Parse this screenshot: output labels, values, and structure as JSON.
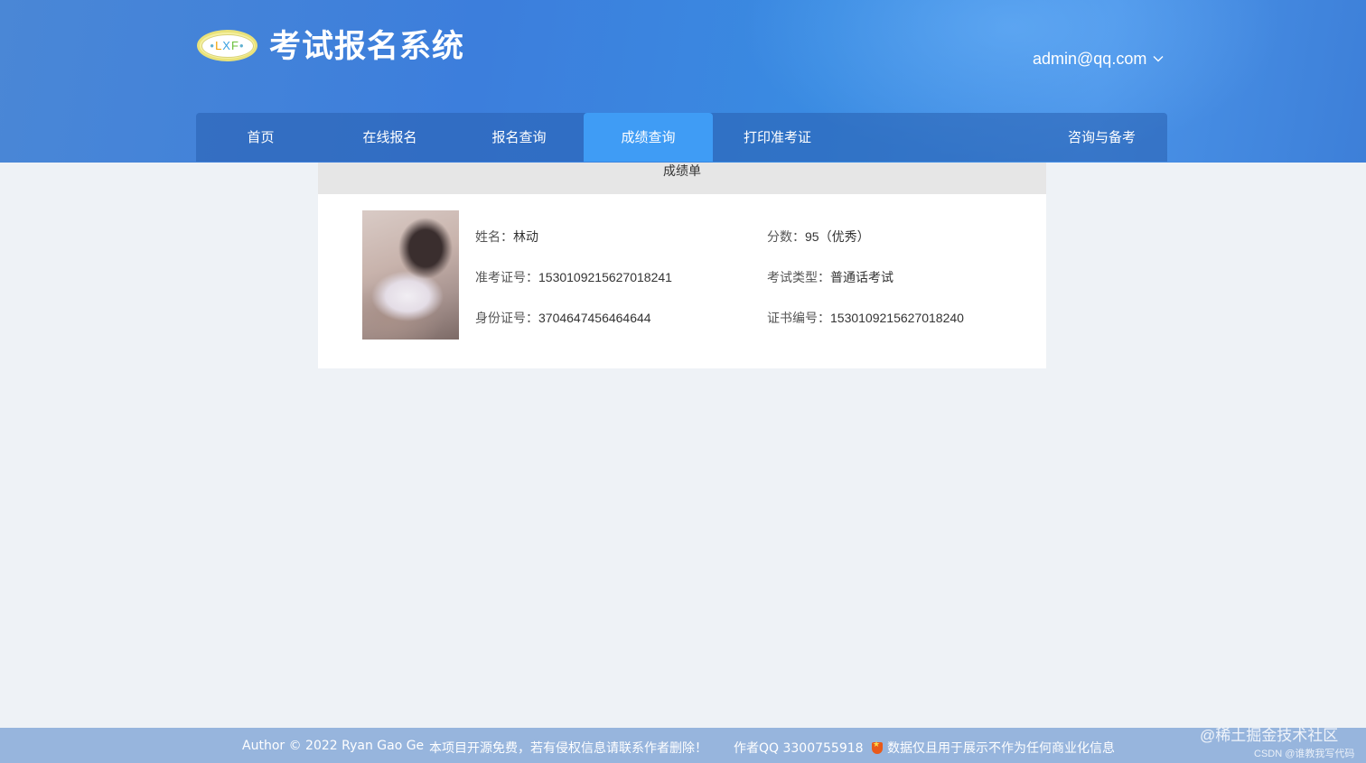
{
  "header": {
    "logo_text": {
      "l": "L",
      "x": "X",
      "f": "F"
    },
    "title": "考试报名系统",
    "user_email": "admin@qq.com"
  },
  "nav": {
    "items": [
      {
        "label": "首页"
      },
      {
        "label": "在线报名"
      },
      {
        "label": "报名查询"
      },
      {
        "label": "成绩查询"
      },
      {
        "label": "打印准考证"
      },
      {
        "label": "咨询与备考"
      }
    ],
    "active_index": 3
  },
  "result": {
    "title": "成绩单",
    "name_label": "姓名：",
    "name_value": "林动",
    "score_label": "分数：",
    "score_value": "95（优秀）",
    "ticket_label": "准考证号：",
    "ticket_value": "1530109215627018241",
    "exam_type_label": "考试类型：",
    "exam_type_value": "普通话考试",
    "id_label": "身份证号：",
    "id_value": "3704647456464644",
    "cert_label": "证书编号：",
    "cert_value": "1530109215627018240"
  },
  "footer": {
    "author": "Author © 2022 Ryan Gao Ge",
    "open_source": "本项目开源免费，若有侵权信息请联系作者删除！",
    "qq": "作者QQ 3300755918",
    "disclaimer": "数据仅且用于展示不作为任何商业化信息"
  },
  "watermark": {
    "main": "@稀土掘金技术社区",
    "sub": "CSDN @谁教我写代码"
  },
  "colors": {
    "header": "#3c7edc",
    "nav_active": "#3f9cf5",
    "footer": "#97b5dd",
    "page_bg": "#eef2f6"
  }
}
